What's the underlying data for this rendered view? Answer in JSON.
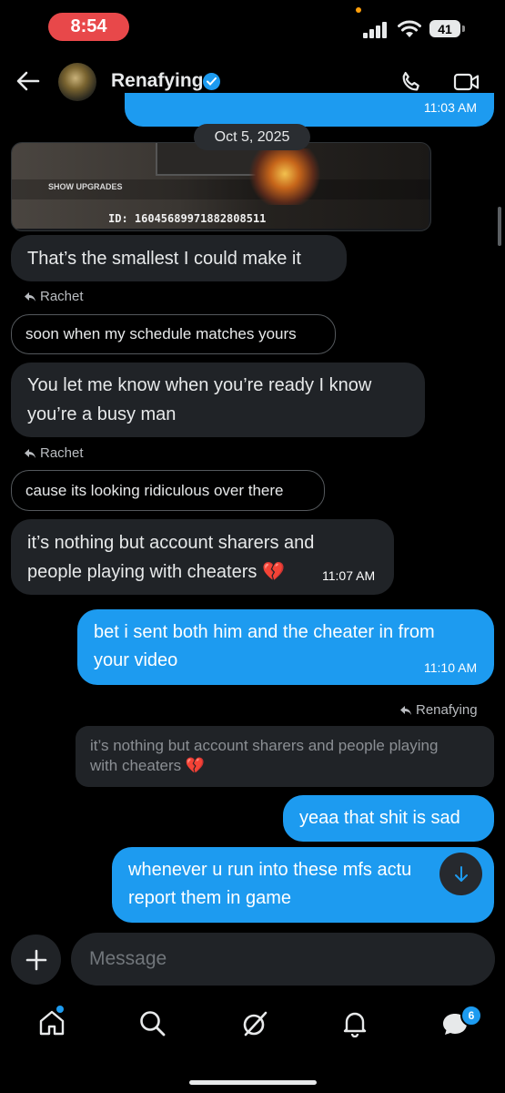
{
  "status_bar": {
    "time": "8:54",
    "battery": "41"
  },
  "header": {
    "contact_name": "Renafying"
  },
  "thread": {
    "top_partial_time": "11:03 AM",
    "date_divider": "Oct 5, 2025",
    "image_caption_upgrades": "SHOW UPGRADES",
    "image_caption_id": "ID: 16045689971882808511",
    "messages": [
      {
        "text": "That’s the smallest I could make it"
      },
      {
        "reply_to": "Rachet",
        "quoted": "soon when my schedule matches yours"
      },
      {
        "text_line1": "You let me know when you’re ready I know",
        "text_line2": "you’re a busy man"
      },
      {
        "reply_to": "Rachet",
        "quoted": "cause its looking ridiculous over there"
      },
      {
        "text_line1": "it’s nothing but account sharers and",
        "text_line2": "people playing with cheaters 💔",
        "time": "11:07 AM"
      },
      {
        "text_line1": "bet i sent both him and the cheater in from",
        "text_line2": "your video",
        "time": "11:10 AM"
      },
      {
        "reply_to": "Renafying",
        "quoted_line1": "it’s nothing but account sharers and people playing",
        "quoted_line2": "with cheaters 💔"
      },
      {
        "text": "yeaa that shit is sad"
      },
      {
        "text_line1": "whenever u run into these mfs actu",
        "text_line2": "report them in game"
      }
    ]
  },
  "composer": {
    "placeholder": "Message"
  },
  "bottom_nav": {
    "messages_badge": "6"
  }
}
